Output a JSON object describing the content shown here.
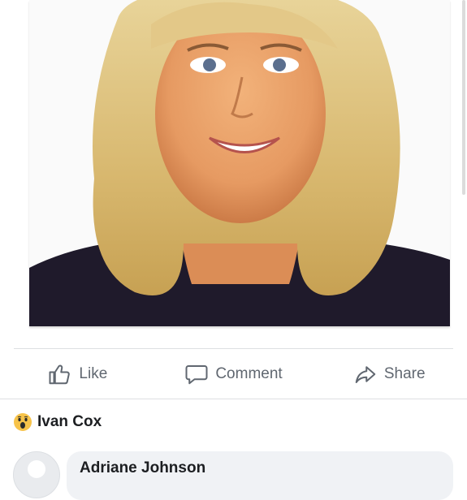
{
  "post": {
    "photo_alt": "photo-of-woman"
  },
  "actions": {
    "like_label": "Like",
    "comment_label": "Comment",
    "share_label": "Share"
  },
  "reaction": {
    "emoji": "wow-icon",
    "name": "Ivan Cox"
  },
  "comment": {
    "author": "Adriane Johnson"
  },
  "colors": {
    "action_text": "#606770",
    "divider": "#dddfe2",
    "bubble_bg": "#f0f2f5",
    "wow_yellow": "#f7c34a"
  }
}
